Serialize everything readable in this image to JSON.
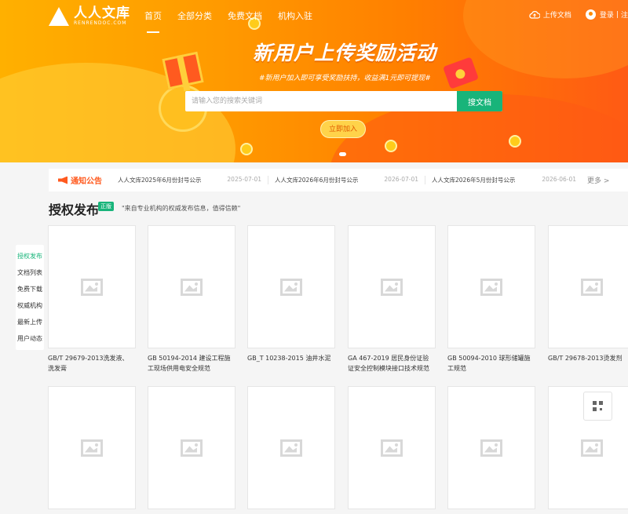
{
  "header": {
    "logo_cn": "人人文库",
    "logo_en": "RENRENDOC.COM",
    "nav": [
      "首页",
      "全部分类",
      "免费文档",
      "机构入驻"
    ],
    "upload_label": "上传文档",
    "login_label": "登录",
    "register_label": "注"
  },
  "banner": {
    "headline": "新用户上传奖励活动",
    "subline": "#新用户加入即可享受奖励扶持，收益满1元即可提现#",
    "search_placeholder": "请输入您的搜索关键词",
    "search_button": "搜文档",
    "join_button": "立即加入"
  },
  "notice": {
    "title": "通知公告",
    "items": [
      {
        "text": "人人文库2025年6月份封号公示",
        "date": "2025-07-01"
      },
      {
        "text": "人人文库2026年6月份封号公示",
        "date": "2026-07-01"
      },
      {
        "text": "人人文库2026年5月份封号公示",
        "date": "2026-06-01"
      }
    ],
    "more": "更多 >"
  },
  "section": {
    "title": "授权发布",
    "badge": "正版",
    "desc": "\"来自专业机构的权威发布信息，值得信赖\""
  },
  "docs": [
    "GB/T 29679-2013洗发液、洗发膏",
    "GB 50194-2014 建设工程施工现场供用电安全规范",
    "GB_T 10238-2015 油井水泥",
    "GA 467-2019 居民身份证验证安全控制模块接口技术规范",
    "GB 50094-2010 球形储罐施工规范",
    "GB/T 29678-2013烫发剂",
    "",
    "",
    "",
    "",
    "",
    ""
  ],
  "sidenav": [
    "授权发布",
    "文档列表",
    "免费下载",
    "权威机构",
    "最新上传",
    "用户动态"
  ],
  "colors": {
    "accent_green": "#18b47a",
    "banner_orange": "#ff8a00",
    "notice_red": "#ff5a1f"
  }
}
